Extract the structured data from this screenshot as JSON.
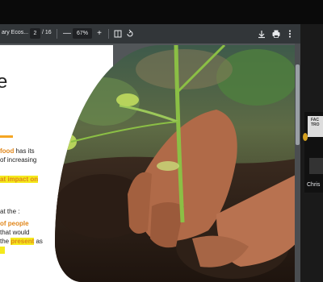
{
  "toolbar": {
    "doc_title": "ary Ecos...",
    "page_current": "2",
    "page_total": "/ 16",
    "zoom_out_label": "—",
    "zoom_value": "67%",
    "zoom_in_label": "+",
    "fit_icon": "fit-page-icon",
    "rotate_icon": "rotate-icon",
    "download_icon": "download-icon",
    "print_icon": "print-icon",
    "more_icon": "more-vert-icon"
  },
  "slide": {
    "heading_fragment": "e",
    "para1_part1": "food",
    "para1_part1_pre": "",
    "para1_line1_rest": " has its",
    "para1_line2": "of increasing",
    "para1_line3_hl": "at impact on",
    "para2_line1": "at the :",
    "para2_line2_orange": "of people",
    "para2_line3": "that would",
    "para2_line4_pre": "the ",
    "para2_line4_hl": "present",
    "para2_line4_post": " as"
  },
  "participant": {
    "tile_text_1": "FAC",
    "tile_text_2": "TRO",
    "name": "Chris"
  },
  "colors": {
    "toolbar_bg": "#323639",
    "accent_orange": "#e0861a",
    "highlight_yellow": "#f4e91c"
  }
}
